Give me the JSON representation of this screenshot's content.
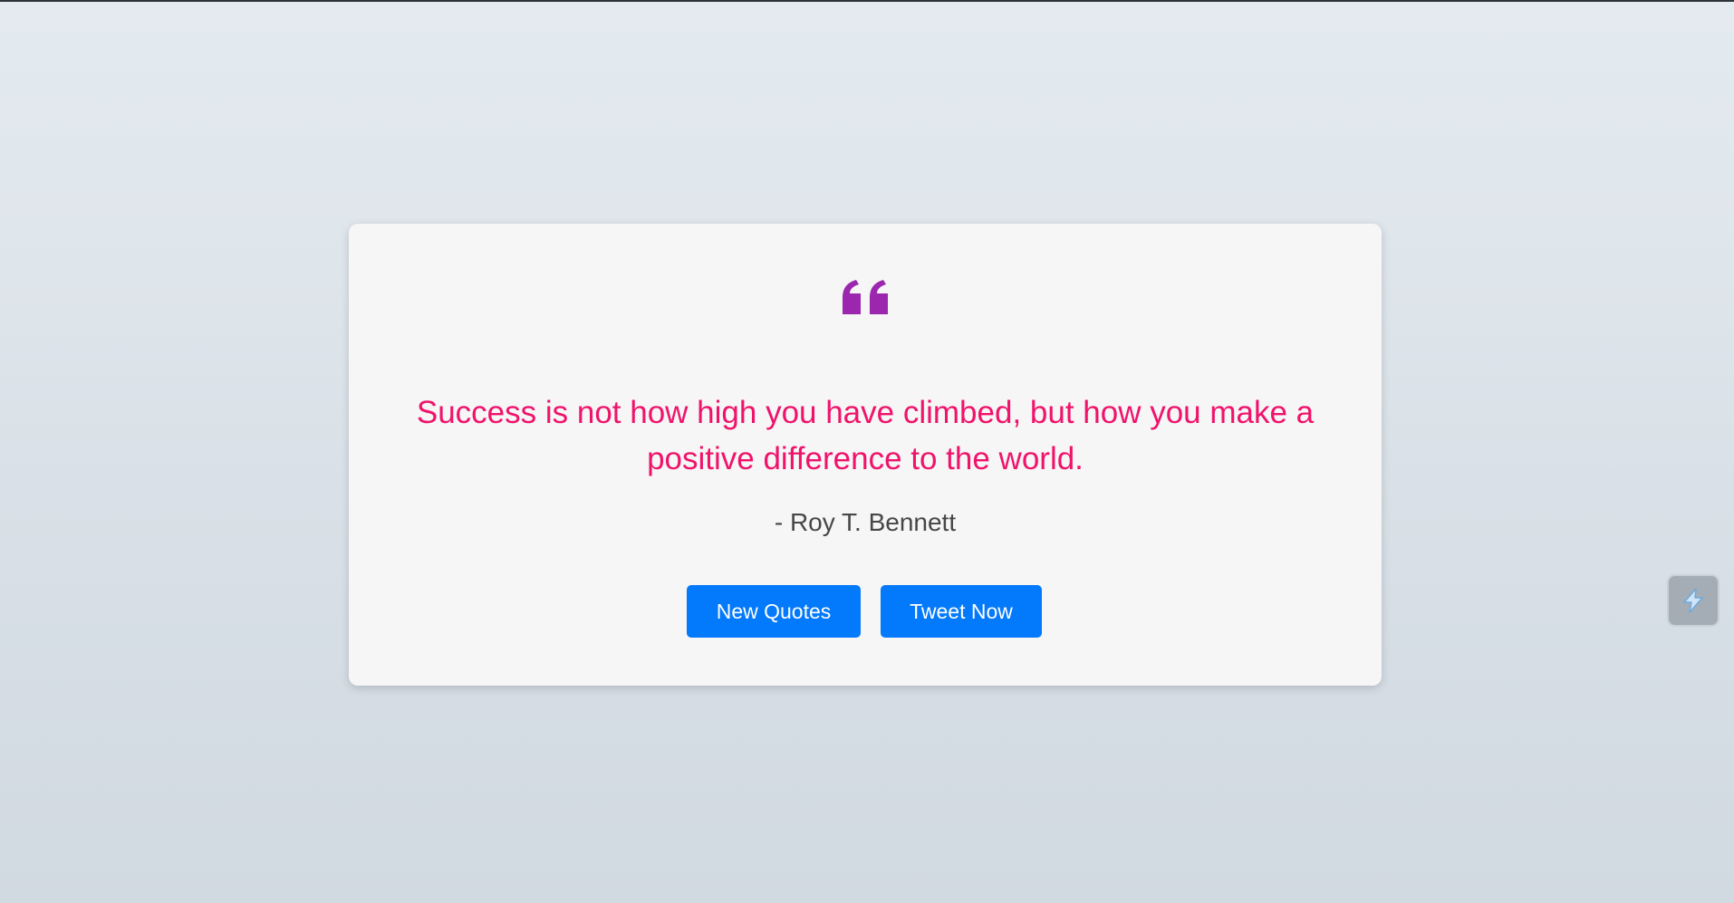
{
  "quote": {
    "icon": "quote-left-icon",
    "text": "Success is not how high you have climbed, but how you make a positive difference to the world.",
    "author": "- Roy T. Bennett"
  },
  "buttons": {
    "new_quote_label": "New Quotes",
    "tweet_label": "Tweet Now"
  },
  "side_widget": {
    "icon": "extension-icon"
  },
  "colors": {
    "quote_text": "#f0136b",
    "quote_icon": "#9b27af",
    "button": "#0379fb",
    "card": "#f6f6f6",
    "author": "#474747"
  }
}
